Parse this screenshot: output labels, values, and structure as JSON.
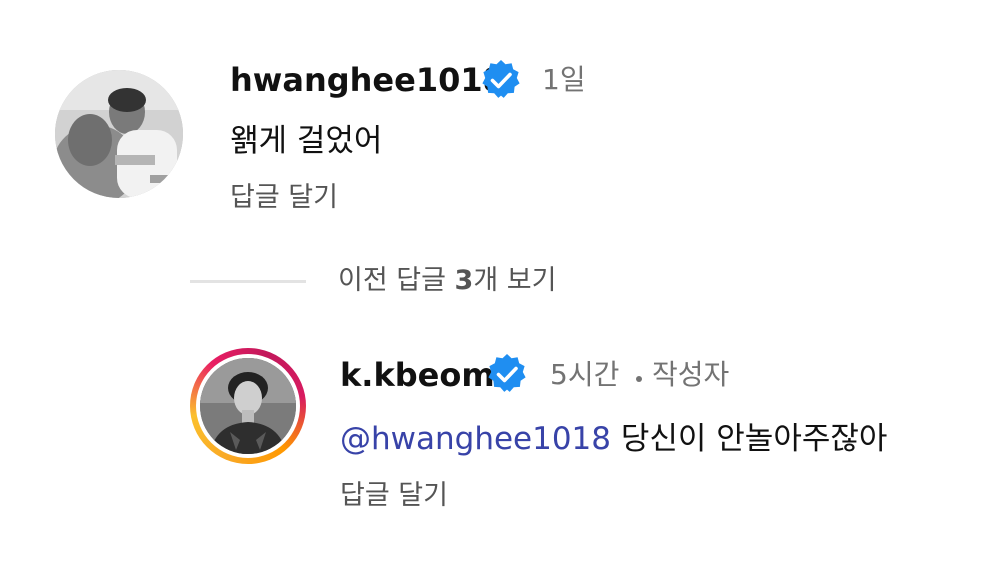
{
  "comments": [
    {
      "username": "hwanghee1018",
      "time": "1일",
      "text": "왥게 걸었어",
      "reply_label": "답글 달기"
    },
    {
      "username": "k.kbeom",
      "time": "5시간",
      "author_label": "작성자",
      "mention": "@hwanghee1018",
      "text": " 당신이 안놀아주잖아",
      "reply_label": "답글 달기"
    }
  ],
  "view_previous": {
    "prefix": "이전 답글 ",
    "count": "3",
    "suffix": "개 보기"
  },
  "colors": {
    "verified_badge": "#1f8ef1",
    "mention": "#3843a8",
    "muted_text": "#737373"
  }
}
